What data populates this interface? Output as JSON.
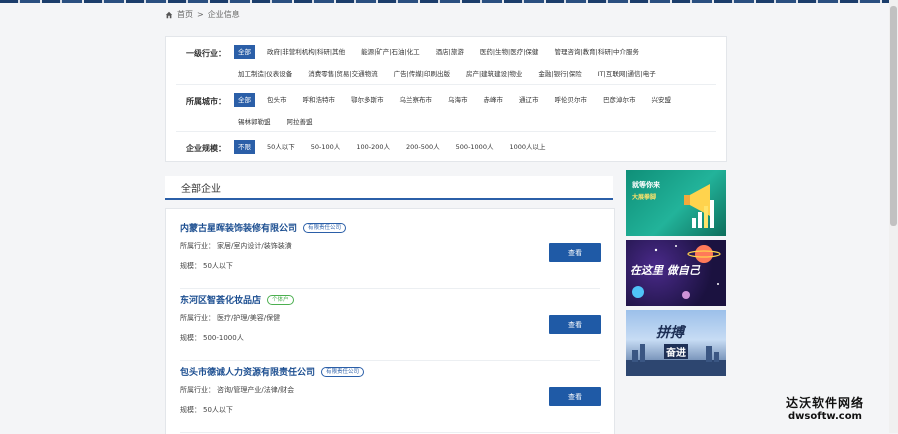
{
  "breadcrumb": {
    "home": "首页",
    "sep": ">",
    "current": "企业信息"
  },
  "filters": {
    "industry": {
      "label": "一级行业：",
      "options": [
        "全部",
        "政府|非营利机构|科研|其他",
        "能源|矿产|石油|化工",
        "酒店|旅游",
        "医药|生物|医疗|保健",
        "管理咨询|教育|科研|中介服务",
        "加工制造|仪表设备",
        "消费零售|贸易|交通物流",
        "广告|传媒|印刷出版",
        "房产|建筑建设|物业",
        "金融|银行|保险",
        "IT|互联网|通信|电子"
      ]
    },
    "city": {
      "label": "所属城市：",
      "options": [
        "全部",
        "包头市",
        "呼和浩特市",
        "鄂尔多斯市",
        "乌兰察布市",
        "乌海市",
        "赤峰市",
        "通辽市",
        "呼伦贝尔市",
        "巴彦淖尔市",
        "兴安盟",
        "锡林郭勒盟",
        "阿拉善盟"
      ]
    },
    "size": {
      "label": "企业规模：",
      "options": [
        "不限",
        "50人以下",
        "50-100人",
        "100-200人",
        "200-500人",
        "500-1000人",
        "1000人以上"
      ]
    }
  },
  "section": {
    "title": "全部企业"
  },
  "companies": [
    {
      "name": "内蒙古星晖装饰装修有限公司",
      "tag": "有限责任公司",
      "industry_label": "所属行业：",
      "industry": "家居/室内设计/装饰装潢",
      "size_label": "规模：",
      "size": "50人以下",
      "button": "查看"
    },
    {
      "name": "东河区智荟化妆品店",
      "tag": "个体户",
      "industry_label": "所属行业：",
      "industry": "医疗/护理/美容/保健",
      "size_label": "规模：",
      "size": "500-1000人",
      "button": "查看"
    },
    {
      "name": "包头市德诚人力资源有限责任公司",
      "tag": "有限责任公司",
      "industry_label": "所属行业：",
      "industry": "咨询/管理产业/法律/财会",
      "size_label": "规模：",
      "size": "50人以下",
      "button": "查看"
    }
  ],
  "ads": [
    {
      "line1": "就等你来",
      "line2": "大展拳脚"
    },
    {
      "line1": "在这里 做自己"
    },
    {
      "line1": "拼搏",
      "line2": "奋进"
    }
  ],
  "watermark": {
    "line1": "达沃软件网络",
    "line2": "dwsoftw.com"
  },
  "colors": {
    "accent": "#2b5fa8",
    "name_link": "#1d4f91",
    "tag_green": "#4caf50"
  }
}
